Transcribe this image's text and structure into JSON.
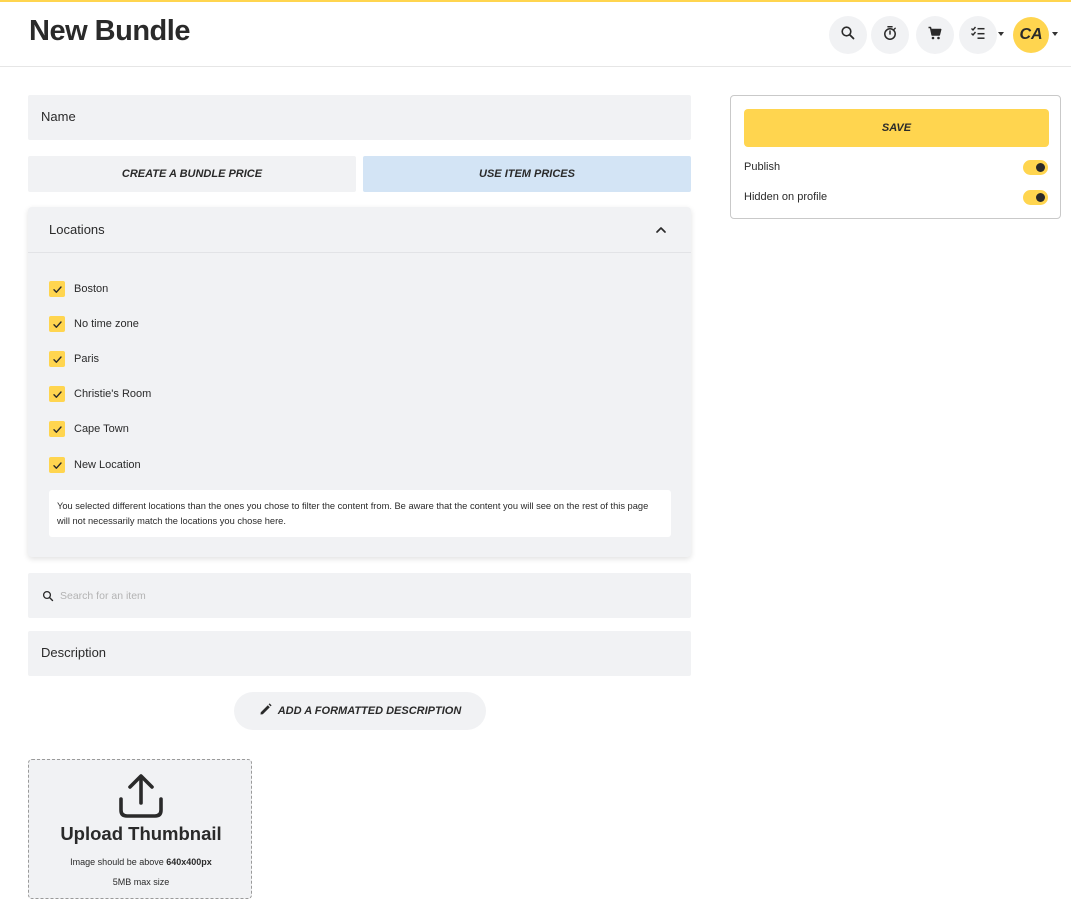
{
  "header": {
    "title": "New Bundle",
    "avatar_initials": "CA",
    "icons": [
      "search-icon",
      "timer-icon",
      "cart-icon",
      "checklist-icon"
    ]
  },
  "form": {
    "name_label": "Name",
    "price_options": {
      "bundle": "CREATE A BUNDLE PRICE",
      "items": "USE ITEM PRICES",
      "selected": "USE ITEM PRICES"
    },
    "locations": {
      "title": "Locations",
      "expanded": true,
      "items": [
        {
          "label": "Boston",
          "checked": true
        },
        {
          "label": "No time zone",
          "checked": true
        },
        {
          "label": "Paris",
          "checked": true
        },
        {
          "label": "Christie's Room",
          "checked": true
        },
        {
          "label": "Cape Town",
          "checked": true
        },
        {
          "label": "New Location",
          "checked": true
        }
      ],
      "warning": "You selected different locations than the ones you chose to filter the content from. Be aware that the content you will see on the rest of this page will not necessarily match the locations you chose here."
    },
    "search": {
      "placeholder": "Search for an item",
      "value": ""
    },
    "description_label": "Description",
    "formatted_description_button": "ADD A FORMATTED DESCRIPTION",
    "upload": {
      "title": "Upload Thumbnail",
      "note_prefix": "Image should be above",
      "note_size": "640x400px",
      "max_size": "5MB max size"
    }
  },
  "sidebar": {
    "save_label": "SAVE",
    "toggles": [
      {
        "label": "Publish",
        "on": true
      },
      {
        "label": "Hidden on profile",
        "on": true
      }
    ]
  },
  "colors": {
    "accent": "#ffd54f",
    "selected_option": "#d3e4f5",
    "field_background": "#f1f2f4"
  }
}
